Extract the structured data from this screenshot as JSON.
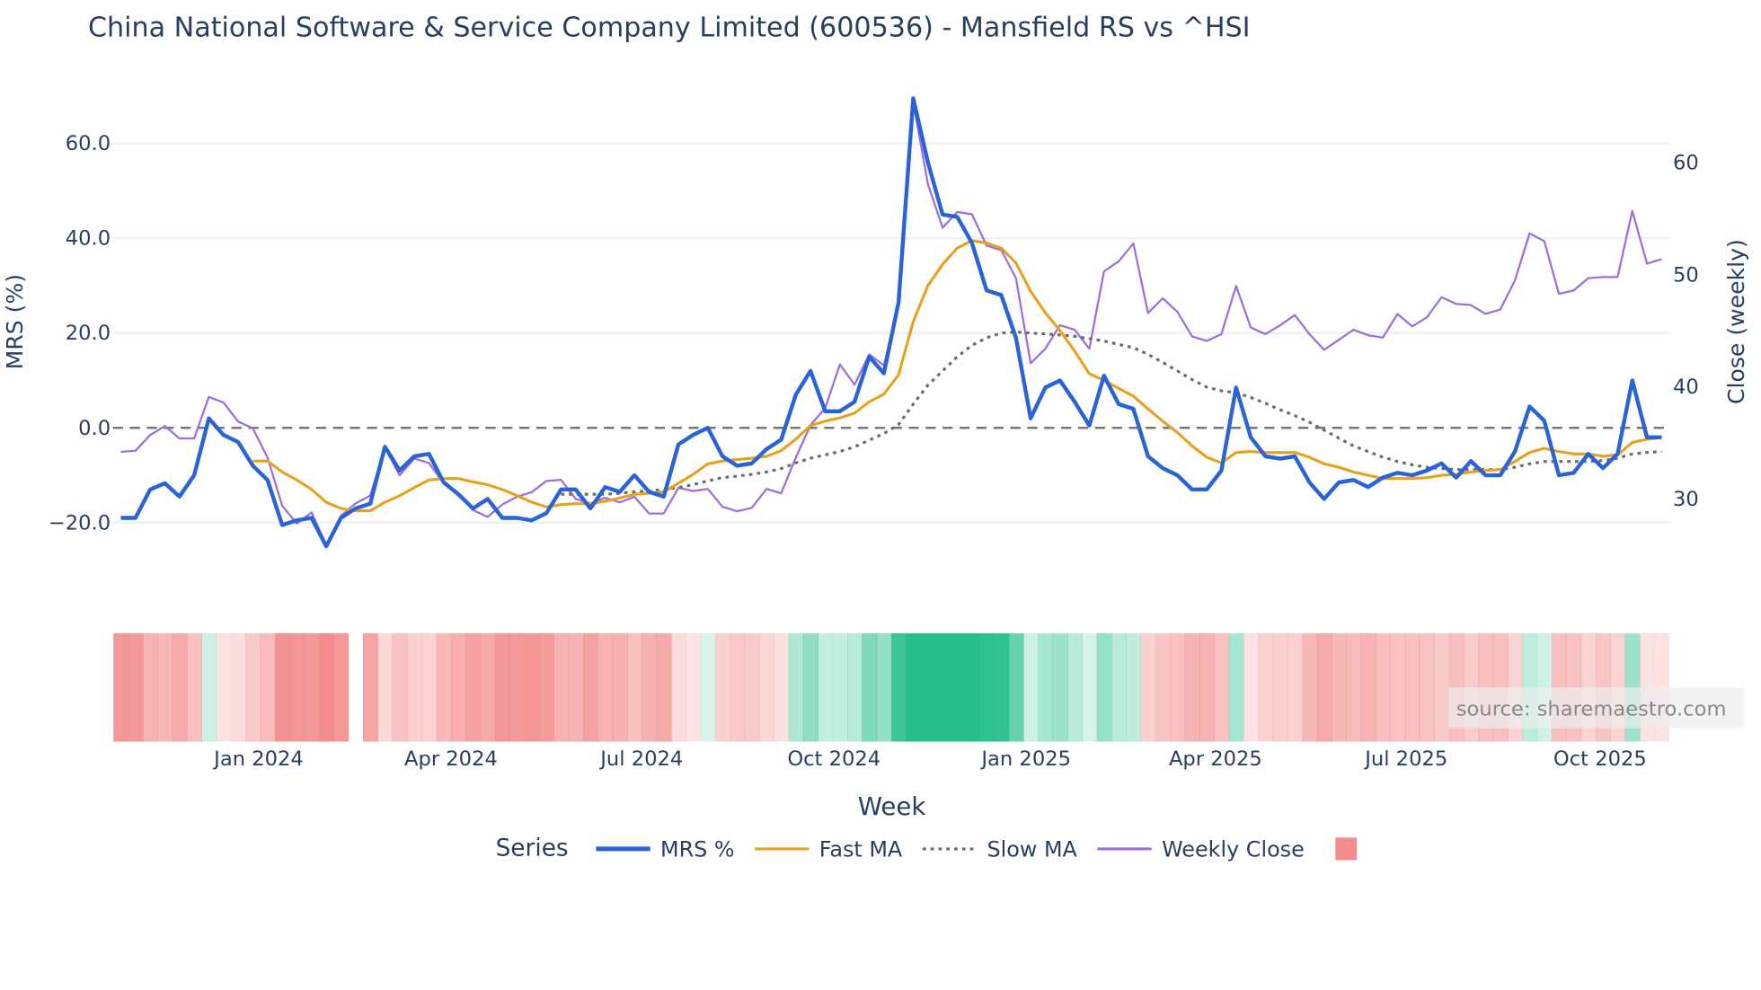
{
  "chart_data": {
    "type": "line",
    "title": "China National Software & Service Company Limited (600536) - Mansfield RS vs ^HSI",
    "xlabel": "Week",
    "ylabel_left": "MRS (%)",
    "ylabel_right": "Close (weekly)",
    "left_ticks": [
      {
        "v": 60,
        "label": "60.0"
      },
      {
        "v": 40,
        "label": "40.0"
      },
      {
        "v": 20,
        "label": "20.0"
      },
      {
        "v": 0,
        "label": "0.0"
      },
      {
        "v": -20,
        "label": "−20.0"
      }
    ],
    "right_ticks": [
      {
        "v": 60,
        "label": "60"
      },
      {
        "v": 50,
        "label": "50"
      },
      {
        "v": 40,
        "label": "40"
      },
      {
        "v": 30,
        "label": "30"
      }
    ],
    "x_ticks": [
      {
        "week": 9.4,
        "label": "Jan 2024"
      },
      {
        "week": 22.5,
        "label": "Apr 2024"
      },
      {
        "week": 35.5,
        "label": "Jul 2024"
      },
      {
        "week": 48.6,
        "label": "Oct 2024"
      },
      {
        "week": 61.7,
        "label": "Jan 2025"
      },
      {
        "week": 74.6,
        "label": "Apr 2025"
      },
      {
        "week": 87.6,
        "label": "Jul 2025"
      },
      {
        "week": 100.8,
        "label": "Oct 2025"
      }
    ],
    "reference_line": 0,
    "heatmap_gap_week": 16,
    "series": [
      {
        "name": "MRS %",
        "color": "#2962d9",
        "values": [
          -19,
          -19,
          -13,
          -11.7,
          -14.5,
          -10,
          2,
          -1.5,
          -3,
          -8,
          -11,
          -20.5,
          -19.5,
          -19,
          -25,
          -19,
          -17,
          -16,
          -4,
          -9,
          -6,
          -5.5,
          -11.5,
          -14,
          -17,
          -15,
          -19,
          -19,
          -19.5,
          -18,
          -13,
          -13,
          -17,
          -12.5,
          -13.5,
          -10,
          -13.5,
          -14.5,
          -3.5,
          -1.5,
          0,
          -6,
          -8,
          -7.5,
          -4.5,
          -2.5,
          7,
          12,
          3.5,
          3.5,
          5.5,
          15,
          11.5,
          26.5,
          69.5,
          56,
          45,
          44.5,
          39,
          29,
          28,
          19,
          2,
          8.5,
          10,
          5.5,
          0.5,
          11,
          5,
          4,
          -6,
          -8.5,
          -10,
          -13,
          -13,
          -9,
          8.5,
          -2,
          -6,
          -6.5,
          -6,
          -11.5,
          -15,
          -11.5,
          -11,
          -12.5,
          -10.5,
          -9.5,
          -10,
          -9,
          -7.5,
          -10.5,
          -7,
          -10,
          -10,
          -5,
          4.5,
          1.5,
          -10,
          -9.5,
          -5.5,
          -8.5,
          -5.5,
          10,
          -2,
          -2
        ]
      },
      {
        "name": "Fast MA",
        "color": "#e5a21f",
        "start_week": 9,
        "values": [
          -7,
          -7,
          -9.3,
          -11,
          -13,
          -15.7,
          -17,
          -17.5,
          -17.5,
          -15.7,
          -14.3,
          -12.6,
          -11,
          -10.7,
          -10.7,
          -11.4,
          -12,
          -13,
          -14.3,
          -15.7,
          -16.7,
          -16.2,
          -16,
          -16,
          -15.5,
          -14.8,
          -14,
          -13.8,
          -13.5,
          -11.7,
          -9.8,
          -7.6,
          -7,
          -6.7,
          -6.4,
          -6,
          -4.8,
          -2.4,
          0.5,
          1.4,
          2.1,
          3.1,
          5.5,
          7.1,
          11.2,
          22.4,
          30,
          34.5,
          37.9,
          39.5,
          39,
          37.9,
          34.8,
          28.8,
          24.3,
          20.5,
          16.2,
          11.4,
          10,
          8.3,
          6.7,
          4,
          1.4,
          -1,
          -3.8,
          -6.2,
          -7.4,
          -5.2,
          -5,
          -5.2,
          -5.2,
          -5.2,
          -6.2,
          -7.6,
          -8.3,
          -9.3,
          -10,
          -10.7,
          -10.7,
          -10.7,
          -10.5,
          -10,
          -9.8,
          -9.3,
          -9,
          -8.8,
          -7.1,
          -5.2,
          -4.3,
          -5,
          -5.5,
          -5.5,
          -6,
          -5.7,
          -3.1,
          -2.4,
          -2.1
        ]
      },
      {
        "name": "Slow MA",
        "color": "#6b6b6b",
        "start_week": 30,
        "values": [
          -14,
          -14,
          -14,
          -14,
          -13.8,
          -13.5,
          -13.3,
          -13,
          -12.6,
          -12,
          -11.2,
          -10.5,
          -10.2,
          -9.8,
          -9.3,
          -8.6,
          -7.4,
          -6.4,
          -5.7,
          -5,
          -4,
          -2.6,
          -1.2,
          0.7,
          5,
          9,
          12,
          15,
          17.4,
          19,
          20,
          20.2,
          20,
          19.8,
          19.6,
          19.3,
          18.8,
          18.3,
          17.6,
          16.9,
          15.5,
          13.8,
          12,
          10.2,
          8.6,
          7.8,
          7.4,
          6.4,
          5.2,
          3.8,
          2.6,
          1.2,
          -0.5,
          -2.2,
          -3.8,
          -5,
          -6.2,
          -7.1,
          -7.8,
          -8.3,
          -8.6,
          -8.8,
          -8.8,
          -8.8,
          -8.8,
          -8.3,
          -7.6,
          -7.1,
          -7.1,
          -7.1,
          -7.1,
          -6.9,
          -6.4,
          -5.5,
          -5.2,
          -5
        ]
      },
      {
        "name": "Weekly Close",
        "color": "#9b6fdc",
        "axis": "right",
        "values": [
          34.1,
          34.2,
          35.6,
          36.4,
          35.3,
          35.3,
          39,
          38.5,
          36.8,
          36.2,
          33.6,
          29.3,
          27.7,
          28.7,
          25.8,
          28.4,
          29.5,
          30.2,
          34.5,
          32,
          33.5,
          33.1,
          31.3,
          30.3,
          28.9,
          28.3,
          29.4,
          30.1,
          30.5,
          31.5,
          31.6,
          29.9,
          29.5,
          30,
          29.6,
          30.1,
          28.6,
          28.6,
          30.9,
          30.6,
          30.8,
          29.2,
          28.8,
          29.1,
          30.8,
          30.4,
          33.6,
          36.5,
          38,
          41.9,
          40.1,
          42.8,
          41.8,
          47.4,
          65.3,
          58,
          54.1,
          55.5,
          55.3,
          52.5,
          52.1,
          49.6,
          42,
          43.3,
          45.4,
          45,
          43.3,
          50.2,
          51.1,
          52.7,
          46.5,
          47.8,
          46.6,
          44.4,
          44,
          44.6,
          48.9,
          45.2,
          44.6,
          45.4,
          46.3,
          44.6,
          43.2,
          44.1,
          45,
          44.5,
          44.3,
          46.4,
          45.3,
          46.1,
          47.9,
          47.3,
          47.2,
          46.4,
          46.8,
          49.4,
          53.6,
          52.9,
          48.2,
          48.5,
          49.6,
          49.7,
          49.7,
          55.6,
          50.9,
          51.3
        ]
      }
    ],
    "heat_colors": {
      "negative": "#f28b8b",
      "positive": "#26bf8c"
    },
    "legend": {
      "title": "Series",
      "placement": "bottom"
    }
  },
  "watermark": "source: sharemaestro.com"
}
